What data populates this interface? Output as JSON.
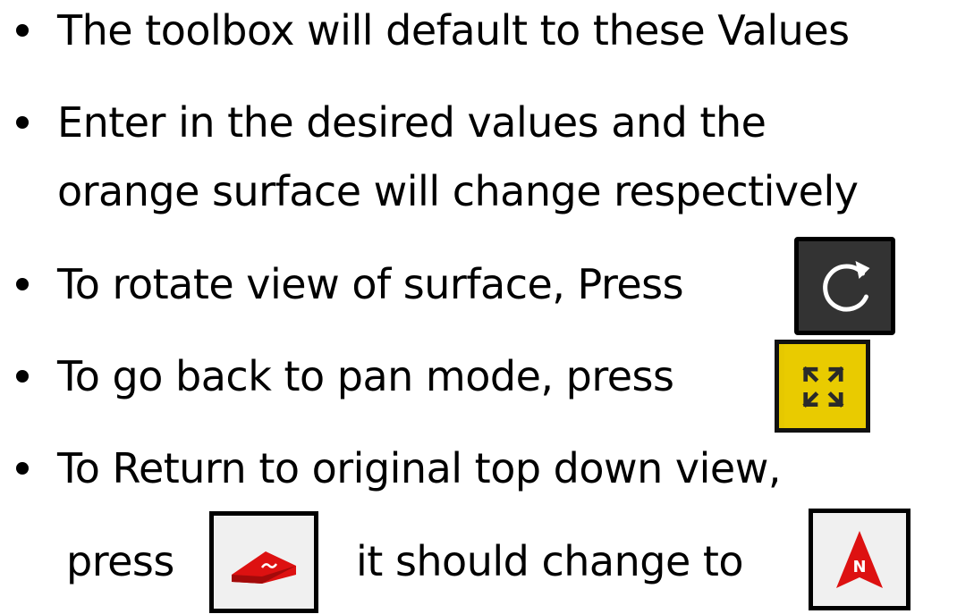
{
  "bullets": [
    {
      "text": "The toolbox will default to these Values"
    },
    {
      "text": "Enter in the desired values and the",
      "continuation": "orange surface will change respectively"
    },
    {
      "text": "To rotate view of surface, Press",
      "icon": "rotate-icon"
    },
    {
      "text": "To go back to pan mode, press",
      "icon": "pan-mode-icon"
    },
    {
      "text": "To Return to original top down view,",
      "continuation_before": "press",
      "continuation_middle": "it should change to",
      "icon_before": "tilted-view-icon",
      "icon_after": "north-arrow-icon"
    }
  ],
  "icons": {
    "rotate": {
      "name": "rotate-icon",
      "background": "#333333",
      "glyph_color": "#ffffff"
    },
    "pan": {
      "name": "pan-mode-icon",
      "background": "#e6c800",
      "glyph_color": "#2a2a2a"
    },
    "tilt": {
      "name": "tilted-view-icon",
      "background": "#f0f0f0",
      "glyph_color": "#dd1111"
    },
    "north": {
      "name": "north-arrow-icon",
      "background": "#f0f0f0",
      "glyph_color": "#dd1111",
      "label": "N"
    }
  }
}
